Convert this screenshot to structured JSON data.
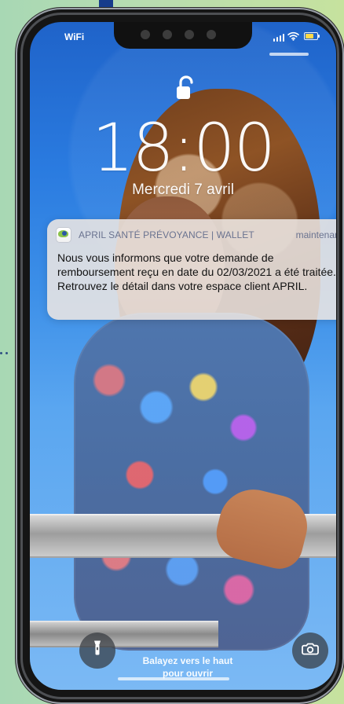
{
  "status_bar": {
    "carrier": "WiFi"
  },
  "lock_screen": {
    "time": "18:00",
    "date": "Mercredi 7 avril"
  },
  "notification": {
    "app_name": "APRIL SANTÉ PRÉVOYANCE | WALLET",
    "timestamp": "maintenant",
    "message": "Nous vous informons que votre demande de remboursement reçu en date du 02/03/2021 a été traitée. Retrouvez le détail dans votre espace client APRIL."
  },
  "bottom_controls": {
    "swipe_line1": "Balayez vers le haut",
    "swipe_line2": "pour ouvrir"
  },
  "icons": {
    "signal": "signal-icon",
    "wifi": "wifi-icon",
    "battery": "battery-icon",
    "lock": "lock-icon",
    "flashlight": "flashlight-icon",
    "camera": "camera-icon"
  },
  "colors": {
    "battery": "#ffd84a",
    "notification_header": "#6a7390"
  }
}
